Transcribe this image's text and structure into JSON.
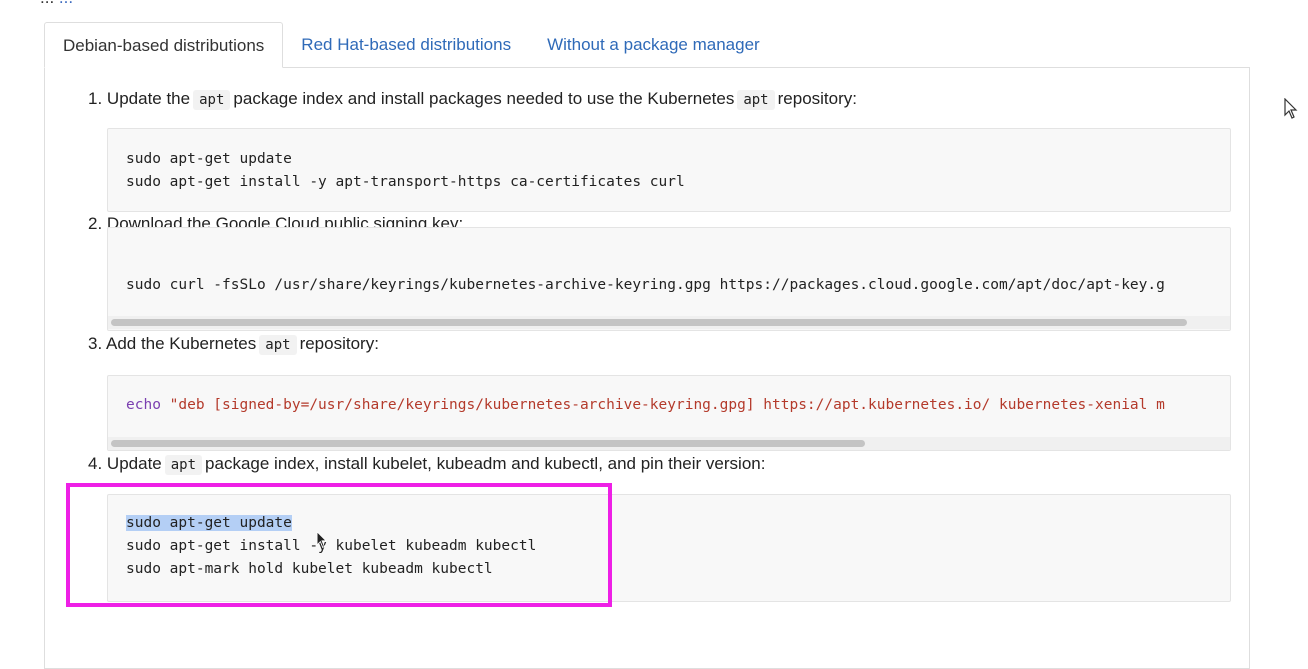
{
  "intro": {
    "text_visible": "...",
    "link_visible": "..."
  },
  "tabs": [
    {
      "label": "Debian-based distributions",
      "active": true
    },
    {
      "label": "Red Hat-based distributions",
      "active": false
    },
    {
      "label": "Without a package manager",
      "active": false
    }
  ],
  "steps": [
    {
      "num": "1.",
      "parts": [
        "Update the",
        "apt",
        "package index and install packages needed to use the Kubernetes",
        "apt",
        "repository:"
      ],
      "code": [
        "sudo apt-get update",
        "sudo apt-get install -y apt-transport-https ca-certificates curl"
      ]
    },
    {
      "num": "2.",
      "text": "Download the Google Cloud public signing key:",
      "code": [
        "sudo curl -fsSLo /usr/share/keyrings/kubernetes-archive-keyring.gpg https://packages.cloud.google.com/apt/doc/apt-key.g"
      ]
    },
    {
      "num": "3.",
      "parts": [
        "Add the Kubernetes",
        "apt",
        "repository:"
      ],
      "code_kw": "echo",
      "code_str": "\"deb [signed-by=/usr/share/keyrings/kubernetes-archive-keyring.gpg] https://apt.kubernetes.io/ kubernetes-xenial m"
    },
    {
      "num": "4.",
      "parts": [
        "Update",
        "apt",
        "package index, install kubelet, kubeadm and kubectl, and pin their version:"
      ],
      "code_selected": "sudo apt-get update",
      "code": [
        "sudo apt-get install -y kubelet kubeadm kubectl",
        "sudo apt-mark hold kubelet kubeadm kubectl"
      ]
    }
  ],
  "colors": {
    "accent_link": "#2f6ab8",
    "highlight_box": "#ee20e6",
    "selection": "#b4cff5",
    "keyword": "#7b3fb0",
    "string": "#b43a2b"
  },
  "icons": {
    "cursor_outside": "arrow-cursor-icon",
    "cursor_in_code": "arrow-cursor-icon"
  }
}
